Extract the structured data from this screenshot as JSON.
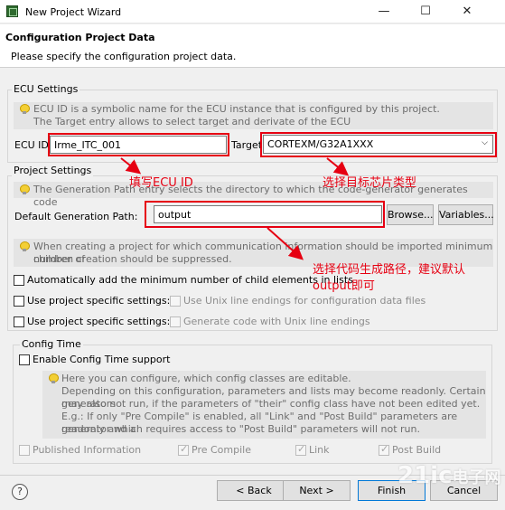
{
  "window": {
    "title": "New Project Wizard",
    "minimize": "—",
    "maximize": "☐",
    "close": "✕"
  },
  "header": {
    "heading": "Configuration Project Data",
    "subtitle": "Please specify the configuration project data."
  },
  "ecu_settings": {
    "group_label": "ECU Settings",
    "info_line1": "ECU ID is a symbolic name for the ECU instance that is configured by this project.",
    "info_line2": "The Target entry allows to select target and derivate of the ECU",
    "ecu_id_label": "ECU ID:",
    "ecu_id_value": "Irme_ITC_001",
    "target_label": "Target:",
    "target_value": "CORTEXM/G32A1XXX"
  },
  "project_settings": {
    "group_label": "Project Settings",
    "info": "The Generation Path entry selects the directory to which the code-generator generates code",
    "gen_path_label": "Default Generation Path:",
    "gen_path_value": "output",
    "browse": "Browse...",
    "variables": "Variables...",
    "comm_info_line1": "When creating a project for which communication information should be imported minimum number of",
    "comm_info_line2": "children creation should be suppressed.",
    "auto_add_label": "Automatically add the minimum number of child elements in lists",
    "specific1_label": "Use project specific settings:",
    "unix_endings_label": "Use Unix line endings for configuration data files",
    "specific2_label": "Use project specific settings:",
    "gen_unix_label": "Generate code with Unix line endings"
  },
  "config_time": {
    "group_label": "Config Time",
    "enable_label": "Enable Config Time support",
    "info_line1": "Here you can configure, which config classes are editable.",
    "info_line2": "Depending on this configuration, parameters and lists may become readonly. Certain generators",
    "info_line3": "may also not run, if the parameters of \"their\" config class have not been edited yet.",
    "info_line4": "E.g.: If only \"Pre Compile\" is enabled, all \"Link\" and \"Post Build\" parameters are readonly and a",
    "info_line5": "generator which requires access to \"Post Build\" parameters will not run.",
    "published_label": "Published Information",
    "precompile_label": "Pre Compile",
    "link_label": "Link",
    "postbuild_label": "Post Build"
  },
  "footer": {
    "help": "?",
    "back": "< Back",
    "next": "Next >",
    "finish": "Finish",
    "cancel": "Cancel"
  },
  "annotations": {
    "ecu_id": "填写ECU ID",
    "target": "选择目标芯片类型",
    "path_line1": "选择代码生成路径，建议默认",
    "path_line2": "output即可"
  },
  "watermark": {
    "line1": "21ic",
    "line2": "电子网"
  }
}
